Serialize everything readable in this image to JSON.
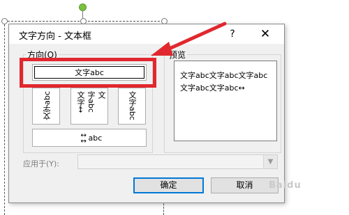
{
  "dialog": {
    "title": "文字方向 - 文本框",
    "help_label": "?",
    "close_label": "✕"
  },
  "orientation": {
    "group_label": "方向(O)",
    "options": [
      {
        "label": "文字abc",
        "direction": "horizontal",
        "selected": true
      },
      {
        "label": "文字abc",
        "direction": "vertical-rotated-ccw"
      },
      {
        "label": "文字abc",
        "direction": "vertical-stacked",
        "col1": "文字↔",
        "col2": "字abc",
        "col3": "文"
      },
      {
        "label": "文字abc",
        "direction": "vertical-rotated-cw"
      },
      {
        "label": "文字abc",
        "direction": "horizontal-mirrored-prefix",
        "prefix": "↕↕",
        "text": "abc"
      }
    ]
  },
  "preview": {
    "group_label": "预览",
    "text": "文字abc文字abc文字abc文字abc文字abc↔"
  },
  "apply_to": {
    "label": "应用于(Y):",
    "value": ""
  },
  "buttons": {
    "ok": "确定",
    "cancel": "取消"
  },
  "watermark": "Baidu",
  "colors": {
    "highlight": "#e0282e",
    "rotate_handle": "#7ac143",
    "default_button_border": "#0078d7"
  }
}
